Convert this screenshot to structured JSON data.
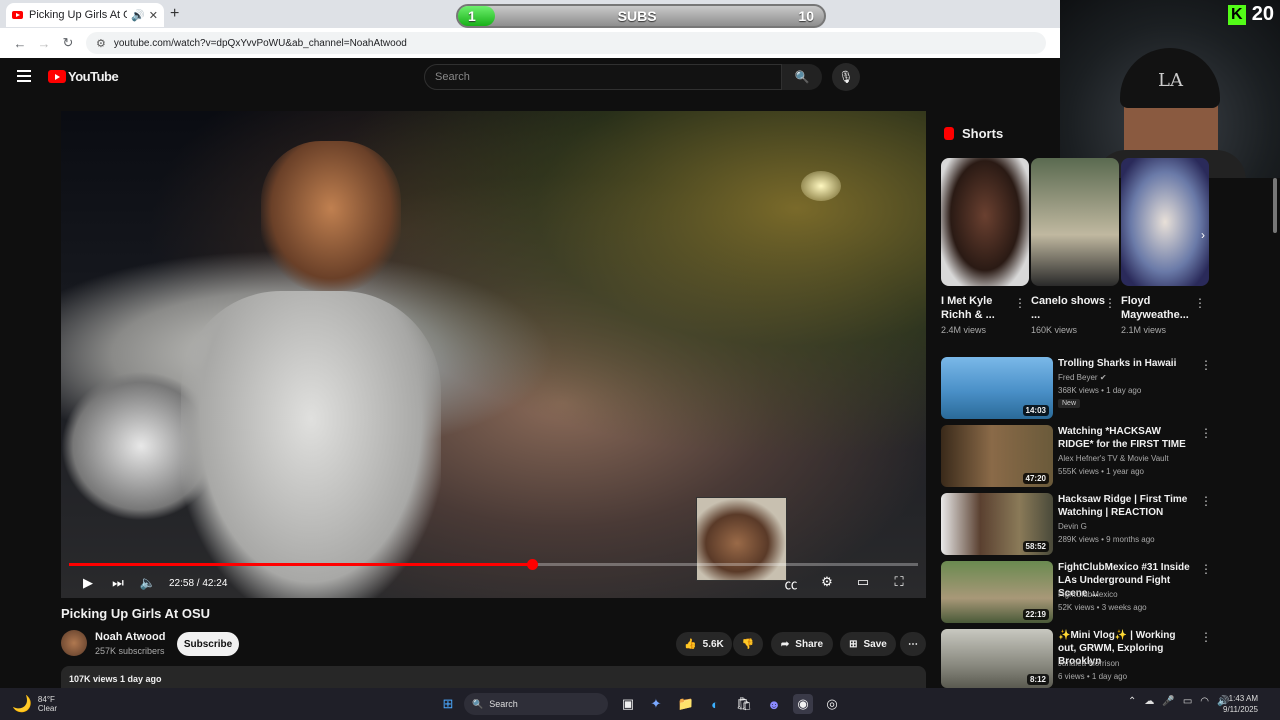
{
  "browser": {
    "tab_title": "Picking Up Girls At OSU - Y",
    "url": "youtube.com/watch?v=dpQxYvvPoWU&ab_channel=NoahAtwood",
    "new_tab": "+",
    "tab_close": "✕"
  },
  "subs_overlay": {
    "current": "1",
    "label": "SUBS",
    "goal": "10",
    "progress_fraction": 0.05
  },
  "webcam": {
    "cap_logo": "LA",
    "kick_logo": "K",
    "kick_count": "20"
  },
  "youtube": {
    "logo_text": "YouTube",
    "search_placeholder": "Search",
    "colors": {
      "brand": "#ff0000",
      "background": "#0f0f0f"
    }
  },
  "player": {
    "time": "22:58 / 42:24",
    "progress_fraction": 0.545,
    "icons": [
      "play-icon",
      "next-icon",
      "volume-icon",
      "captions-icon",
      "settings-icon",
      "theater-icon",
      "fullscreen-icon"
    ]
  },
  "video": {
    "title": "Picking Up Girls At OSU",
    "channel": "Noah Atwood",
    "subscribers": "257K subscribers",
    "subscribe_label": "Subscribe",
    "likes": "5.6K",
    "share_label": "Share",
    "save_label": "Save",
    "views_date": "107K views  1 day ago"
  },
  "sidebar": {
    "shorts_label": "Shorts",
    "shorts": [
      {
        "title": "I Met Kyle Richh & ...",
        "views": "2.4M views"
      },
      {
        "title": "Canelo shows ...",
        "views": "160K views"
      },
      {
        "title": "Floyd Mayweathe...",
        "views": "2.1M views"
      }
    ],
    "videos": [
      {
        "title": "Trolling Sharks in Hawaii",
        "channel": "Fred Beyer",
        "meta": "368K views • 1 day ago",
        "duration": "14:03",
        "badge": "New"
      },
      {
        "title": "Watching *HACKSAW RIDGE* for the FIRST TIME",
        "channel": "Alex Hefner's TV & Movie Vault",
        "meta": "555K views • 1 year ago",
        "duration": "47:20"
      },
      {
        "title": "Hacksaw Ridge | First Time Watching | REACTION",
        "channel": "Devin G",
        "meta": "289K views • 9 months ago",
        "duration": "58:52"
      },
      {
        "title": "FightClubMexico #31 Inside LAs Underground Fight Scene ...",
        "channel": "FightClubMexico",
        "meta": "52K views • 3 weeks ago",
        "duration": "22:19"
      },
      {
        "title": "✨Mini Vlog✨ | Working out, GRWM, Exploring Brooklyn",
        "channel": "Janaiea Morrison",
        "meta": "6 views • 1 day ago",
        "duration": "8:12"
      }
    ]
  },
  "taskbar": {
    "temp": "84°F",
    "condition": "Clear",
    "search_label": "Search",
    "time": "1:43 AM",
    "date": "9/11/2025"
  }
}
